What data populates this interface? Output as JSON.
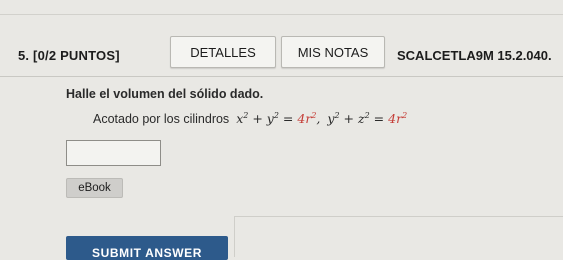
{
  "question": {
    "number_label": "5. [0/2 PUNTOS]",
    "details_button": "DETALLES",
    "notes_button": "MIS NOTAS",
    "course_code": "SCALCETLA9M 15.2.040."
  },
  "problem": {
    "prompt": "Halle el volumen del sólido dado.",
    "bounded_text": "Acotado por los cilindros",
    "eq1_lhs": "x",
    "eq1_mid": "+ y",
    "eq1_eq": "=",
    "eq1_coef": "4r",
    "eq2_lhs": "y",
    "eq2_mid": "+ z",
    "eq2_eq": "=",
    "eq2_coef": "4r",
    "exp": "2"
  },
  "answer": {
    "value": ""
  },
  "ebook_label": "eBook",
  "submit_label": "SUBMIT ANSWER",
  "colors": {
    "accent": "#2d5a8b",
    "highlight": "#c43c36"
  }
}
